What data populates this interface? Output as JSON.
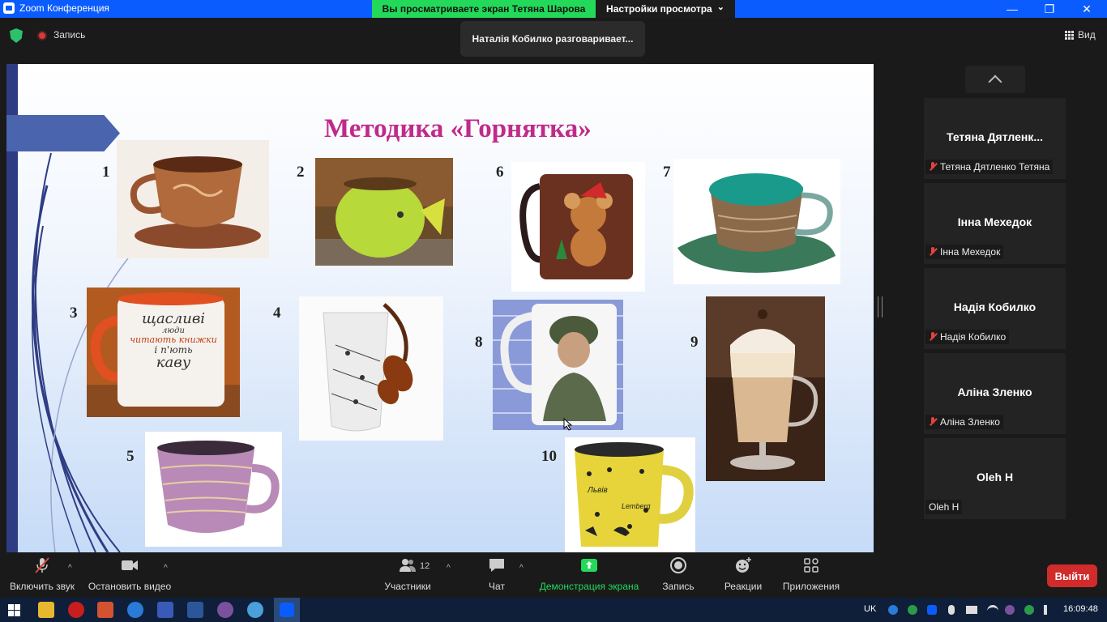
{
  "window": {
    "title": "Zoom Конференция",
    "minimize": "—",
    "maximize": "❐",
    "close": "✕"
  },
  "share": {
    "banner": "Вы просматриваете экран Тетяна Шарова",
    "view_settings": "Настройки просмотра",
    "caret": "⌄"
  },
  "topbar": {
    "record_label": "Запись",
    "speaker": "Наталія Кобилко разговаривает...",
    "view_label": "Вид"
  },
  "slide": {
    "title": "Методика «Горнятка»",
    "numbers": [
      "1",
      "2",
      "3",
      "4",
      "5",
      "6",
      "7",
      "8",
      "9",
      "10"
    ],
    "mug3_text": [
      "щасливі",
      "люди",
      "читають книжки",
      "і п'ють",
      "каву"
    ],
    "mug10_text": [
      "Львів",
      "Lemberg"
    ]
  },
  "participants": [
    {
      "name": "Тетяна  Дятленк...",
      "label": "Тетяна Дятленко Тетяна",
      "muted": true
    },
    {
      "name": "Інна Мехедок",
      "label": "Інна Мехедок",
      "muted": true
    },
    {
      "name": "Надія Кобилко",
      "label": "Надія Кобилко",
      "muted": true
    },
    {
      "name": "Аліна Зленко",
      "label": "Аліна Зленко",
      "muted": true
    },
    {
      "name": "Oleh H",
      "label": "Oleh H",
      "muted": false
    }
  ],
  "toolbar": {
    "audio": "Включить звук",
    "video": "Остановить видео",
    "participants": "Участники",
    "participants_count": "12",
    "chat": "Чат",
    "share": "Демонстрация экрана",
    "record": "Запись",
    "reactions": "Реакции",
    "apps": "Приложения",
    "leave": "Выйти",
    "caret": "^"
  },
  "taskbar": {
    "lang": "UK",
    "time": "16:09:48"
  },
  "colors": {
    "zoom_blue": "#0b5cff",
    "share_green": "#23d959",
    "leave_red": "#d12b2b",
    "title_magenta": "#c02a8a"
  }
}
